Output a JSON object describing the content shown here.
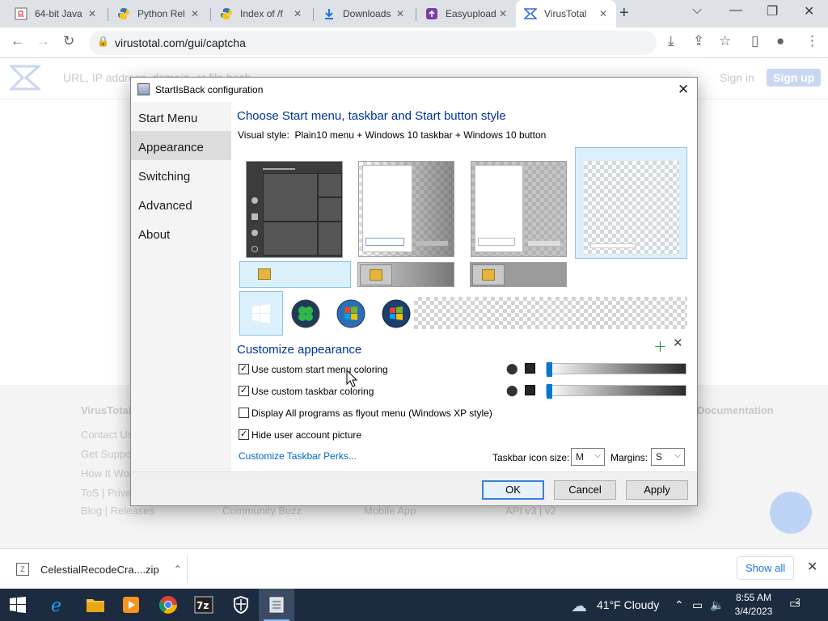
{
  "browser": {
    "tabs": [
      {
        "title": "64-bit Java",
        "icon": "java-icon"
      },
      {
        "title": "Python Rel",
        "icon": "python-icon"
      },
      {
        "title": "Index of /f",
        "icon": "python-icon"
      },
      {
        "title": "Downloads",
        "icon": "download-icon"
      },
      {
        "title": "Easyupload",
        "icon": "easyupload-icon"
      },
      {
        "title": "VirusTotal",
        "icon": "virustotal-icon"
      }
    ],
    "url": "virustotal.com/gui/captcha"
  },
  "page": {
    "search_placeholder": "URL, IP address, domain, or file hash",
    "sign_in": "Sign in",
    "sign_up": "Sign up",
    "footer": {
      "col1_title": "VirusTotal",
      "col1": [
        "Contact Us",
        "Get Support",
        "How It Works",
        "ToS | Privacy Notice",
        "Blog | Releases"
      ],
      "col2": [
        "Community Buzz"
      ],
      "col3": [
        "Mobile App"
      ],
      "col4": [
        "API v3 | v2"
      ],
      "col5_title": "Documentation"
    }
  },
  "dialog": {
    "title": "StartIsBack configuration",
    "nav": [
      "Start Menu",
      "Appearance",
      "Switching",
      "Advanced",
      "About"
    ],
    "selected_nav": 1,
    "heading": "Choose Start menu, taskbar and Start button style",
    "visual_style_label": "Visual style:",
    "visual_style_value": "Plain10 menu + Windows 10 taskbar + Windows 10 button",
    "customize_heading": "Customize appearance",
    "checkboxes": [
      {
        "label": "Use custom start menu coloring",
        "checked": true
      },
      {
        "label": "Use custom taskbar coloring",
        "checked": true
      },
      {
        "label": "Display All programs as flyout menu (Windows XP style)",
        "checked": false
      },
      {
        "label": "Hide user account picture",
        "checked": true
      }
    ],
    "check_mark": "✓",
    "perks_link": "Customize Taskbar Perks...",
    "taskbar_icon_size_label": "Taskbar icon size:",
    "taskbar_icon_size_value": "M",
    "margins_label": "Margins:",
    "margins_value": "S",
    "slider_levels": [
      0.0,
      0.0
    ],
    "buttons": {
      "ok": "OK",
      "cancel": "Cancel",
      "apply": "Apply"
    }
  },
  "downloads": {
    "file": "CelestialRecodeCra....zip",
    "show_all": "Show all"
  },
  "taskbar": {
    "weather": "41°F  Cloudy",
    "time": "8:55 AM",
    "date": "3/4/2023",
    "notifications": "2"
  },
  "colors": {
    "accent": "#0078d7",
    "link": "#0066cc",
    "heading": "#003399",
    "taskbar": "#1c2b3f"
  }
}
